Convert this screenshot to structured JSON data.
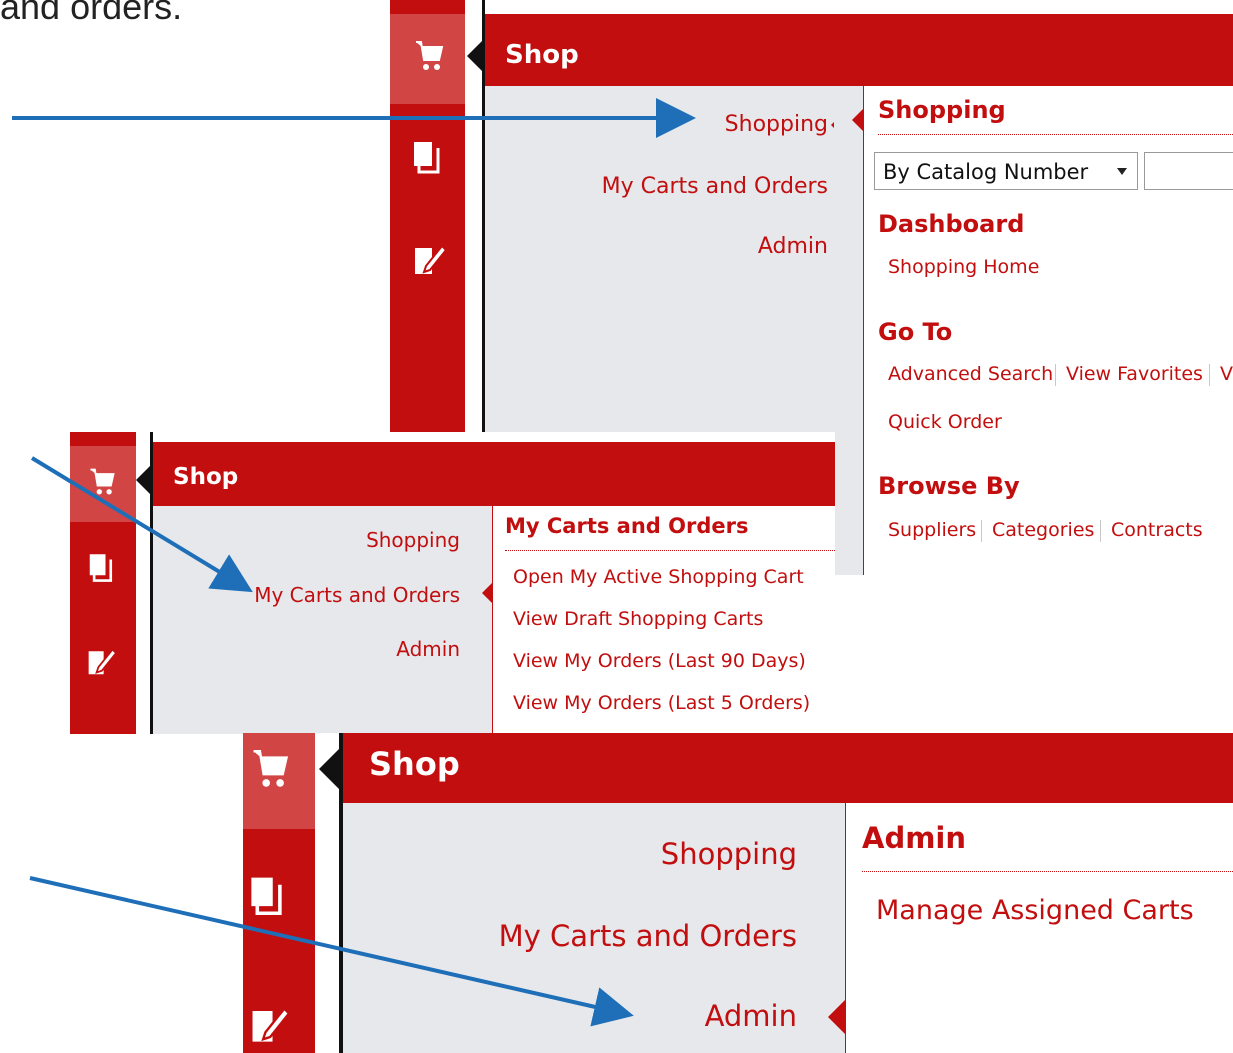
{
  "intro": {
    "text": "and orders."
  },
  "colors": {
    "brand_red": "#c20e0e",
    "menu_bg": "#e6e8ec",
    "arrow_blue": "#1e6fb8"
  },
  "screens": [
    {
      "header_title": "Shop",
      "nav_icons": [
        "cart-icon",
        "documents-icon",
        "edit-note-icon"
      ],
      "menu": {
        "items": [
          "Shopping",
          "My Carts and Orders",
          "Admin"
        ],
        "active_index": 0
      },
      "content": {
        "title": "Shopping",
        "search": {
          "selected": "By Catalog Number",
          "options_icon": "dropdown-arrow-icon",
          "value": ""
        },
        "dashboard": {
          "title": "Dashboard",
          "links": [
            "Shopping Home"
          ]
        },
        "goto": {
          "title": "Go To",
          "links": [
            "Advanced Search",
            "View Favorites",
            "V"
          ],
          "links2": [
            "Quick Order"
          ]
        },
        "browse": {
          "title": "Browse By",
          "links": [
            "Suppliers",
            "Categories",
            "Contracts"
          ]
        }
      }
    },
    {
      "header_title": "Shop",
      "nav_icons": [
        "cart-icon",
        "documents-icon",
        "edit-note-icon"
      ],
      "menu": {
        "items": [
          "Shopping",
          "My Carts and Orders",
          "Admin"
        ],
        "active_index": 1
      },
      "content": {
        "title": "My Carts and Orders",
        "links": [
          "Open My Active Shopping Cart",
          "View Draft Shopping Carts",
          "View My Orders (Last 90 Days)",
          "View My Orders (Last 5 Orders)"
        ]
      }
    },
    {
      "header_title": "Shop",
      "nav_icons": [
        "cart-icon",
        "documents-icon",
        "edit-note-icon"
      ],
      "menu": {
        "items": [
          "Shopping",
          "My Carts and Orders",
          "Admin"
        ],
        "active_index": 2
      },
      "content": {
        "title": "Admin",
        "links": [
          "Manage Assigned Carts"
        ]
      }
    }
  ]
}
